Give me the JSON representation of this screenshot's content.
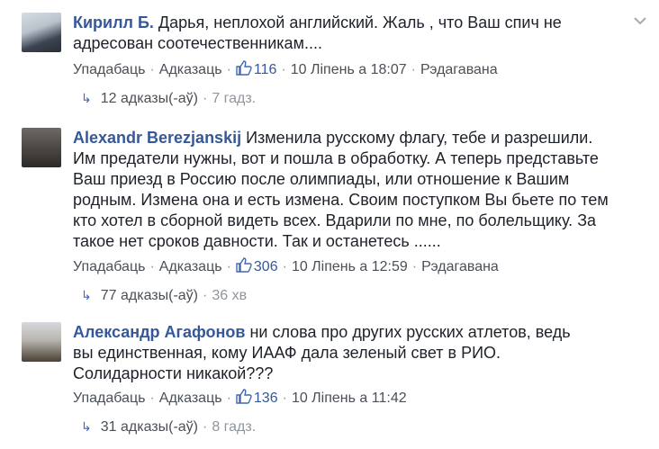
{
  "comments": [
    {
      "author": "Кирилл Б.",
      "text": "Дарья, неплохой английский. Жаль , что Ваш спич не адресован соотечественникам....",
      "like_action": "Упадабаць",
      "reply_action": "Адказаць",
      "likes": "116",
      "date": "10 Ліпень а 18:07",
      "edited": "Рэдагавана",
      "replies_count": "12 адказы(-аў)",
      "replies_time": "7 гадз."
    },
    {
      "author": "Alexandr Berezjanskij",
      "text": "Изменила русскому флагу, тебе и разрешили. Им предатели нужны, вот и пошла в обработку. А теперь представьте Ваш приезд в Россию после олимпиады, или отношение к Вашим родным. Измена она и есть измена. Своим поступком Вы бьете по тем кто хотел в сборной видеть всех. Вдарили по мне, по болельщику. За такое нет сроков давности. Так и останетесь ......",
      "like_action": "Упадабаць",
      "reply_action": "Адказаць",
      "likes": "306",
      "date": "10 Ліпень а 12:59",
      "edited": "Рэдагавана",
      "replies_count": "77 адказы(-аў)",
      "replies_time": "36 хв"
    },
    {
      "author": "Александр Агафонов",
      "text": "ни слова про других русских атлетов, ведь вы единственная, кому ИААФ дала зеленый свет в РИО. Солидарности никакой???",
      "like_action": "Упадабаць",
      "reply_action": "Адказаць",
      "likes": "136",
      "date": "10 Ліпень а 11:42",
      "replies_count": "31 адказы(-аў)",
      "replies_time": "8 гадз."
    }
  ],
  "icons": {
    "like": "thumbs-up-icon",
    "reply_arrow": "reply-arrow-icon",
    "menu": "chevron-down-icon"
  },
  "colors": {
    "author": "#365899",
    "meta": "#90949c",
    "text": "#1d2129"
  }
}
